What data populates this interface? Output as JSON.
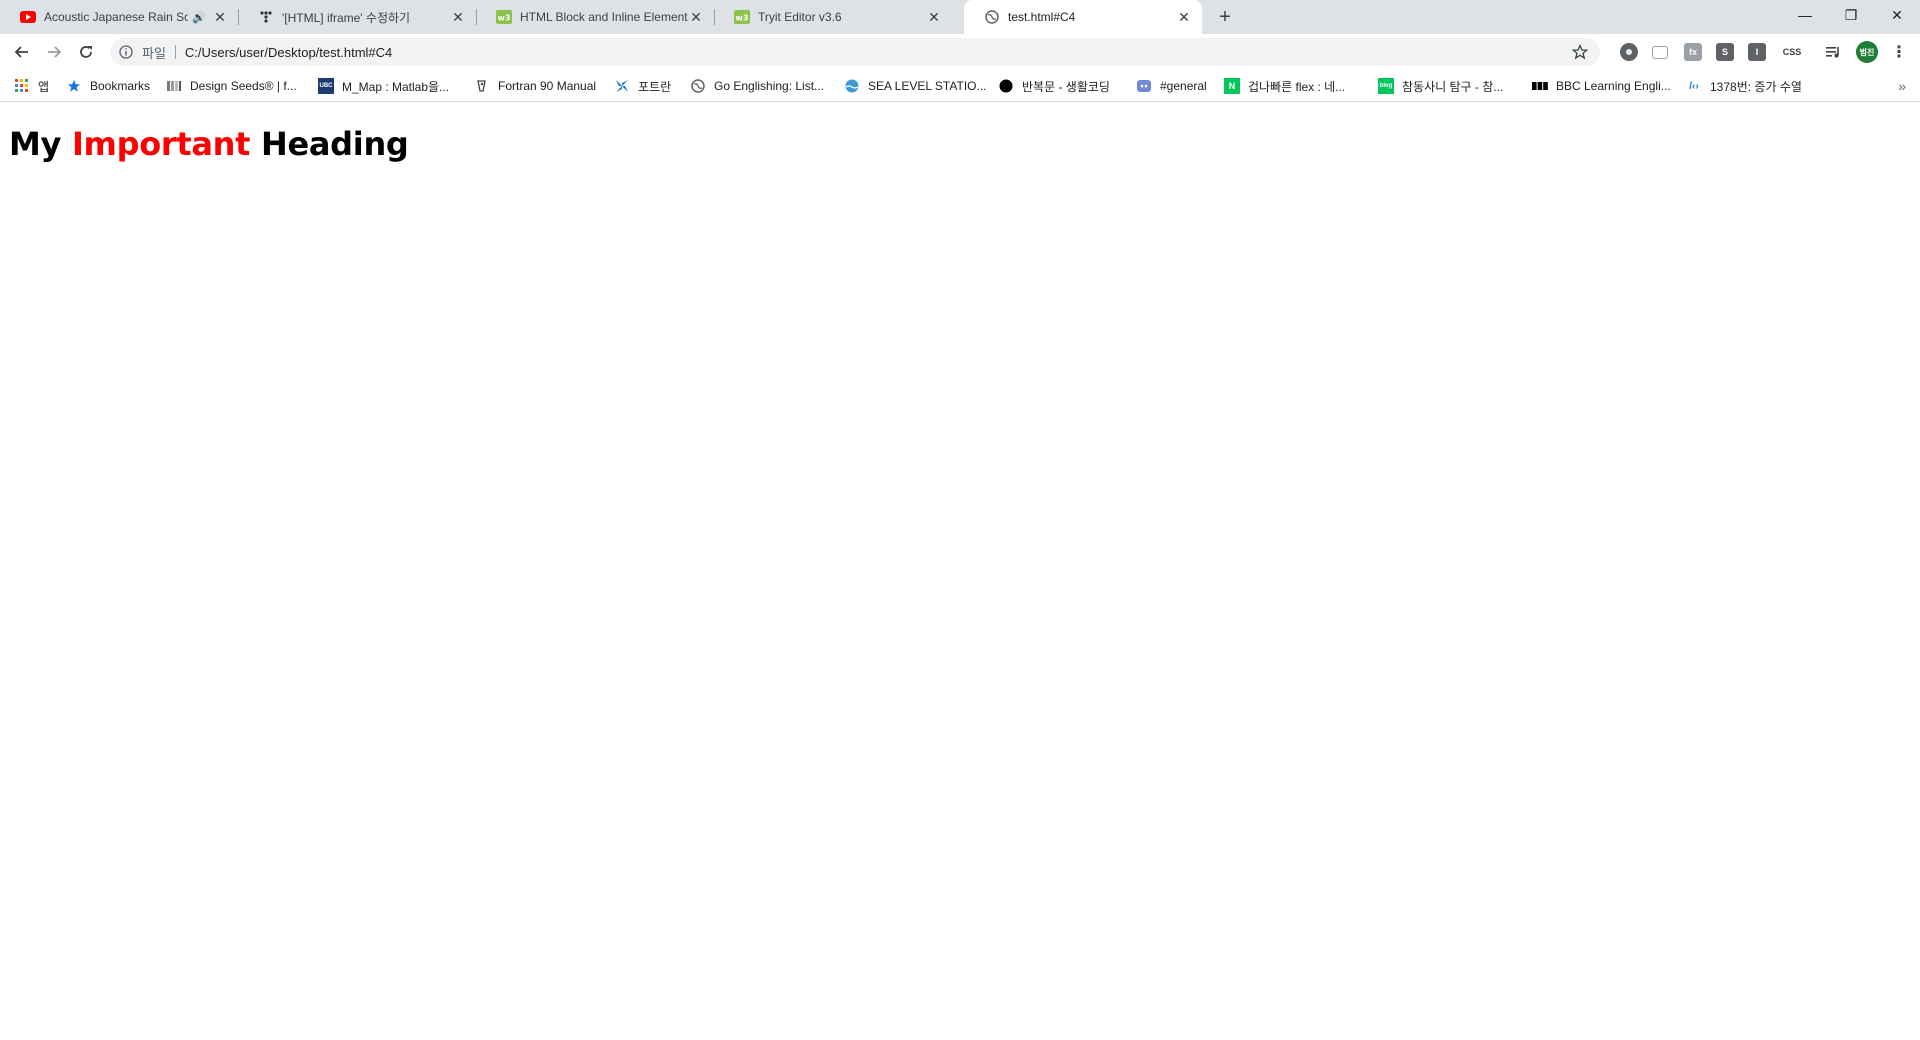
{
  "browser": {
    "tabs": [
      {
        "title": "Acoustic Japanese Rain Song",
        "icon": "youtube-icon",
        "audio": "🔊"
      },
      {
        "title": "'[HTML] iframe' 수정하기",
        "icon": "tistory-icon"
      },
      {
        "title": "HTML Block and Inline Elements",
        "icon": "w3schools-icon"
      },
      {
        "title": "Tryit Editor v3.6",
        "icon": "w3schools-icon"
      },
      {
        "title": "test.html#C4",
        "icon": "globe-icon",
        "active": true
      }
    ],
    "new_tab": "+",
    "window": {
      "minimize": "—",
      "restore": "❐",
      "close": "✕"
    },
    "address": {
      "chip": "파일",
      "url": "C:/Users/user/Desktop/test.html#C4"
    },
    "extensions": [
      {
        "icon": "extension-dot-icon",
        "label": ""
      },
      {
        "icon": "extension-window-icon",
        "label": ""
      },
      {
        "icon": "extension-fx-icon",
        "label": "fx"
      },
      {
        "icon": "extension-s-icon",
        "label": "S"
      },
      {
        "icon": "extension-i-icon",
        "label": "I"
      },
      {
        "icon": "extension-css-icon",
        "label": "CSS"
      }
    ],
    "profile": {
      "label": "범진",
      "color": "#1e7e34"
    },
    "bookmarks": [
      {
        "label": "앱",
        "icon": "apps-grid-icon"
      },
      {
        "label": "Bookmarks",
        "icon": "star-icon"
      },
      {
        "label": "Design Seeds® | f...",
        "icon": "design-seeds-icon"
      },
      {
        "label": "M_Map : Matlab을...",
        "icon": "ubc-icon"
      },
      {
        "label": "Fortran 90 Manual",
        "icon": "fortran-icon"
      },
      {
        "label": "포트란",
        "icon": "pinwheel-icon"
      },
      {
        "label": "Go Englishing: List...",
        "icon": "globe-icon"
      },
      {
        "label": "SEA LEVEL STATIO...",
        "icon": "sea-level-icon"
      },
      {
        "label": "반복문 - 생활코딩",
        "icon": "black-circle-icon"
      },
      {
        "label": "#general",
        "icon": "discord-icon"
      },
      {
        "label": "겁나빠른 flex : 네...",
        "icon": "naver-icon"
      },
      {
        "label": "참동사니 탐구 - 참...",
        "icon": "naver-blog-icon"
      },
      {
        "label": "BBC Learning Engli...",
        "icon": "bbc-icon"
      },
      {
        "label": "1378번: 증가 수열",
        "icon": "code-icon"
      }
    ],
    "bookmarks_more": "»"
  },
  "page": {
    "heading_before": "My ",
    "heading_highlight": "Important",
    "heading_after": " Heading",
    "highlight_color": "#ff0000"
  }
}
